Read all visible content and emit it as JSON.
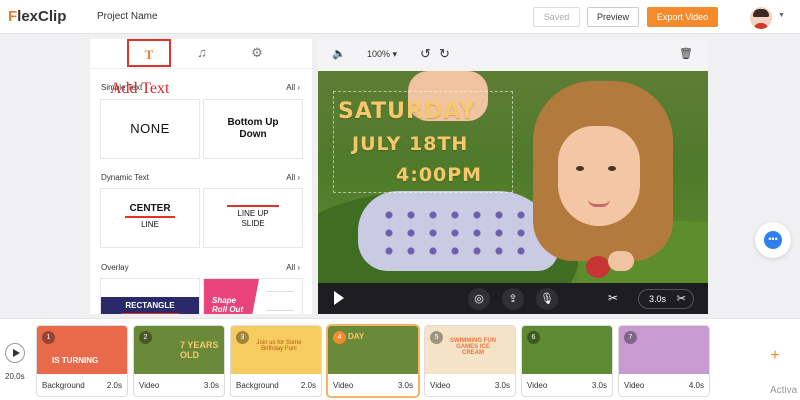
{
  "app": {
    "logo_mark": "F",
    "logo_rest": "lexClip",
    "project_name": "Project Name"
  },
  "toolbar": {
    "saved_label": "Saved",
    "preview_label": "Preview",
    "export_label": "Export Video",
    "accent_color": "#f58a2c"
  },
  "left_panel": {
    "tabs": [
      {
        "icon": "text-icon",
        "glyph": "T"
      },
      {
        "icon": "music-icon",
        "glyph": "♫"
      },
      {
        "icon": "gear-icon",
        "glyph": "⚙"
      }
    ],
    "annotation": "Add Text",
    "sections": [
      {
        "title": "Simple Text",
        "all_label": "All",
        "cards": [
          {
            "text": "NONE"
          },
          {
            "line1": "Bottom Up",
            "line2": "Down"
          }
        ]
      },
      {
        "title": "Dynamic Text",
        "all_label": "All",
        "cards": [
          {
            "line1": "CENTER",
            "line2": "LINE"
          },
          {
            "line1": "LINE UP",
            "line2": "SLIDE"
          }
        ]
      },
      {
        "title": "Overlay",
        "all_label": "All",
        "cards": [
          {
            "text": "RECTANGLE"
          },
          {
            "line1": "Shape",
            "line2": "Roll Out"
          }
        ]
      }
    ]
  },
  "preview": {
    "zoom": "100%",
    "overlay_lines": [
      "SATURDAY",
      "JULY 18TH",
      "4:00PM"
    ],
    "duration": "3.0s"
  },
  "timeline": {
    "total_duration": "20.0s",
    "clips": [
      {
        "index": "1",
        "type": "Background",
        "duration": "2.0s",
        "thumb_text": "IS TURNING",
        "thumb_color": "#e96a4a",
        "selected": false
      },
      {
        "index": "2",
        "type": "Video",
        "duration": "3.0s",
        "thumb_text": "7 YEARS OLD",
        "thumb_color": "#6a8a3a",
        "selected": false
      },
      {
        "index": "3",
        "type": "Background",
        "duration": "2.0s",
        "thumb_text": "Join us for Some Birthday Fun!",
        "thumb_color": "#f7cc5e",
        "selected": false
      },
      {
        "index": "4",
        "type": "Video",
        "duration": "3.0s",
        "thumb_text": "DAY",
        "thumb_color": "#6a8a3a",
        "selected": true
      },
      {
        "index": "5",
        "type": "Video",
        "duration": "3.0s",
        "thumb_text": "SWIMMING FUN GAMES ICE CREAM",
        "thumb_color": "#f5e3c8",
        "selected": false
      },
      {
        "index": "6",
        "type": "Video",
        "duration": "3.0s",
        "thumb_text": "",
        "thumb_color": "#5f8a34",
        "selected": false
      },
      {
        "index": "7",
        "type": "Video",
        "duration": "4.0s",
        "thumb_text": "",
        "thumb_color": "#c79ad0",
        "selected": false
      }
    ]
  },
  "misc": {
    "watermark": "Activa"
  }
}
